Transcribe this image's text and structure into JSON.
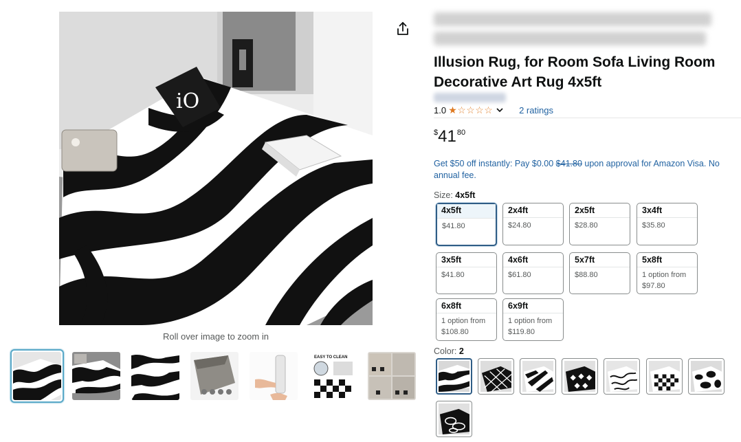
{
  "header": {
    "title": "Illusion Rug, for Room Sofa Living Room Decorative Art Rug 4x5ft"
  },
  "gallery": {
    "zoom_hint": "Roll over image to zoom in",
    "thumbnail_count": 7,
    "selected_thumbnail": 1,
    "badge_text": "EASY TO CLEAN"
  },
  "rating": {
    "value": "1.0",
    "stars_filled": 1,
    "stars_total": 5,
    "count_label": "2 ratings"
  },
  "price": {
    "symbol": "$",
    "whole": "41",
    "fraction": "80"
  },
  "promo": {
    "prefix": "Get $50 off instantly: Pay $0.00 ",
    "strike": "$41.80",
    "suffix": " upon approval for Amazon Visa. No annual fee."
  },
  "size": {
    "label": "Size: ",
    "selected": "4x5ft",
    "options": [
      {
        "name": "4x5ft",
        "price": "$41.80",
        "selected": true
      },
      {
        "name": "2x4ft",
        "price": "$24.80"
      },
      {
        "name": "2x5ft",
        "price": "$28.80"
      },
      {
        "name": "3x4ft",
        "price": "$35.80"
      },
      {
        "name": "3x5ft",
        "price": "$41.80"
      },
      {
        "name": "4x6ft",
        "price": "$61.80"
      },
      {
        "name": "5x7ft",
        "price": "$88.80"
      },
      {
        "name": "5x8ft",
        "price": "1 option from $97.80"
      },
      {
        "name": "6x8ft",
        "price": "1 option from $108.80"
      },
      {
        "name": "6x9ft",
        "price": "1 option from $119.80"
      }
    ]
  },
  "color": {
    "label": "Color: ",
    "selected": "2",
    "swatch_count": 8,
    "swatch_patterns": [
      "wave",
      "diamond",
      "zebra",
      "tile",
      "swirl",
      "checker",
      "cow",
      "circles"
    ]
  },
  "colors": {
    "link": "#2162a1",
    "star": "#de7921",
    "selected_border": "#2f5d86",
    "thumb_selected": "#5aa9c8"
  }
}
